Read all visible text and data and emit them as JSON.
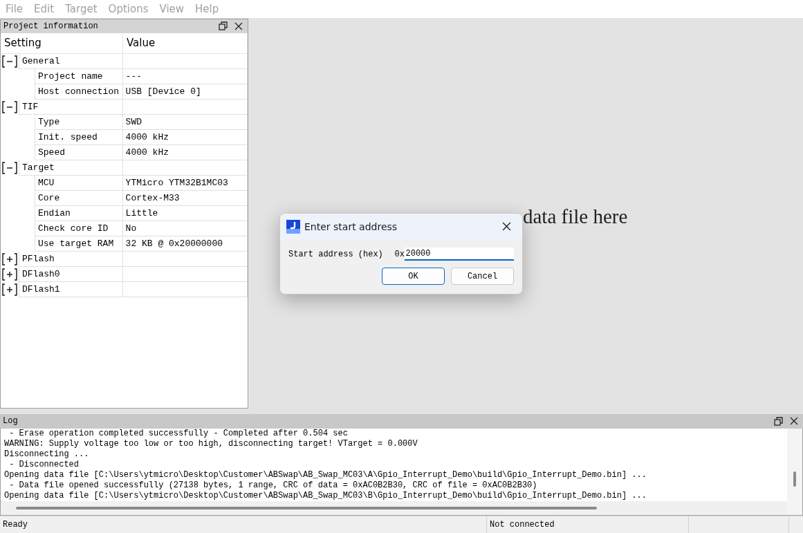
{
  "menu": [
    "File",
    "Edit",
    "Target",
    "Options",
    "View",
    "Help"
  ],
  "project_panel": {
    "title": "Project information",
    "columns": [
      "Setting",
      "Value"
    ],
    "groups": [
      {
        "name": "General",
        "expanded": true,
        "children": [
          {
            "setting": "Project name",
            "value": "---"
          },
          {
            "setting": "Host connection",
            "value": "USB [Device 0]"
          }
        ]
      },
      {
        "name": "TIF",
        "expanded": true,
        "children": [
          {
            "setting": "Type",
            "value": "SWD"
          },
          {
            "setting": "Init. speed",
            "value": "4000 kHz"
          },
          {
            "setting": "Speed",
            "value": "4000 kHz"
          }
        ]
      },
      {
        "name": "Target",
        "expanded": true,
        "children": [
          {
            "setting": "MCU",
            "value": "YTMicro YTM32B1MC03"
          },
          {
            "setting": "Core",
            "value": "Cortex-M33"
          },
          {
            "setting": "Endian",
            "value": "Little"
          },
          {
            "setting": "Check core ID",
            "value": "No"
          },
          {
            "setting": "Use target RAM",
            "value": "32 KB @ 0x20000000"
          }
        ]
      },
      {
        "name": "PFlash",
        "expanded": false
      },
      {
        "name": "DFlash0",
        "expanded": false
      },
      {
        "name": "DFlash1",
        "expanded": false
      }
    ]
  },
  "drop_hint": "data file here",
  "dialog": {
    "title": "Enter start address",
    "label": "Start address (hex)",
    "prefix": "0x",
    "value": "20000",
    "buttons": [
      "OK",
      "Cancel"
    ]
  },
  "log": {
    "title": "Log",
    "lines": [
      " - Erase operation completed successfully - Completed after 0.504 sec",
      "WARNING: Supply voltage too low or too high, disconnecting target! VTarget = 0.000V",
      "Disconnecting ...",
      " - Disconnected",
      "Opening data file [C:\\Users\\ytmicro\\Desktop\\Customer\\ABSwap\\AB_Swap_MC03\\A\\Gpio_Interrupt_Demo\\build\\Gpio_Interrupt_Demo.bin] ...",
      " - Data file opened successfully (27138 bytes, 1 range, CRC of data = 0xAC0B2B30, CRC of file = 0xAC0B2B30)",
      "Opening data file [C:\\Users\\ytmicro\\Desktop\\Customer\\ABSwap\\AB_Swap_MC03\\B\\Gpio_Interrupt_Demo\\build\\Gpio_Interrupt_Demo.bin] ..."
    ]
  },
  "status_bar": [
    "Ready",
    "Not connected"
  ]
}
